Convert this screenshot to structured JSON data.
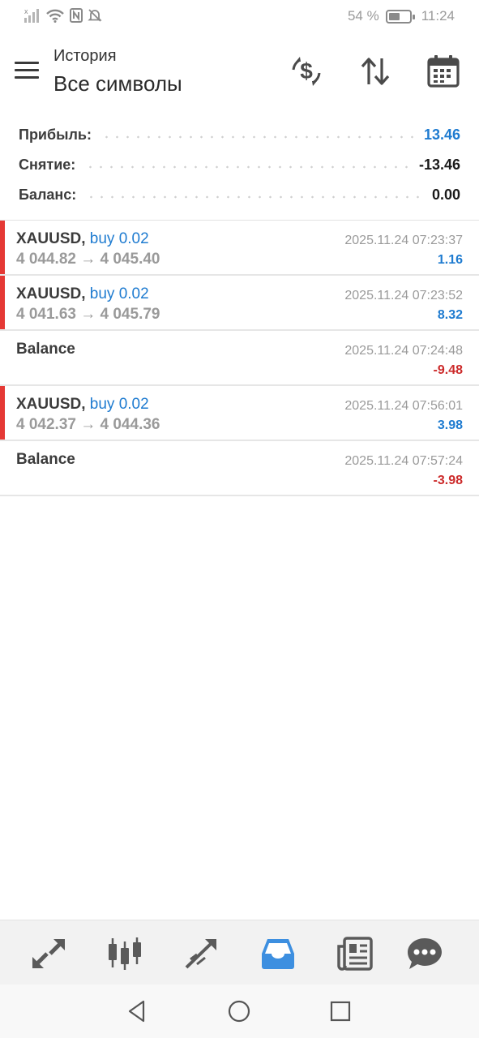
{
  "status_bar": {
    "battery_text": "54 %",
    "battery_level": 0.54,
    "time": "11:24"
  },
  "header": {
    "title": "История",
    "subtitle": "Все символы"
  },
  "summary": [
    {
      "label": "Прибыль:",
      "value": "13.46",
      "color": "#1e7bd0"
    },
    {
      "label": "Снятие:",
      "value": "-13.46",
      "color": "#1a1a1a"
    },
    {
      "label": "Баланс:",
      "value": "0.00",
      "color": "#1a1a1a"
    }
  ],
  "records": [
    {
      "symbol": "XAUUSD,",
      "type": "buy 0.02",
      "prices": "4 044.82 → 4 045.40",
      "time": "2025.11.24 07:23:37",
      "profit": "1.16",
      "sign": "pos",
      "marker": true
    },
    {
      "symbol": "XAUUSD,",
      "type": "buy 0.02",
      "prices": "4 041.63 → 4 045.79",
      "time": "2025.11.24 07:23:52",
      "profit": "8.32",
      "sign": "pos",
      "marker": true
    },
    {
      "symbol": "Balance",
      "type": "",
      "prices": "",
      "time": "2025.11.24 07:24:48",
      "profit": "-9.48",
      "sign": "neg",
      "marker": false
    },
    {
      "symbol": "XAUUSD,",
      "type": "buy 0.02",
      "prices": "4 042.37 → 4 044.36",
      "time": "2025.11.24 07:56:01",
      "profit": "3.98",
      "sign": "pos",
      "marker": true
    },
    {
      "symbol": "Balance",
      "type": "",
      "prices": "",
      "time": "2025.11.24 07:57:24",
      "profit": "-3.98",
      "sign": "neg",
      "marker": false
    }
  ],
  "bottom_nav": [
    {
      "icon": "quotes-icon"
    },
    {
      "icon": "chart-icon"
    },
    {
      "icon": "trade-icon"
    },
    {
      "icon": "history-icon",
      "active": true
    },
    {
      "icon": "news-icon"
    },
    {
      "icon": "chat-icon"
    }
  ],
  "colors": {
    "accent": "#1e7bd0",
    "loss": "#cc2a2a",
    "buy_marker": "#e53935",
    "active_nav": "#3d8fe0",
    "icon_gray": "#5a5a5a"
  }
}
